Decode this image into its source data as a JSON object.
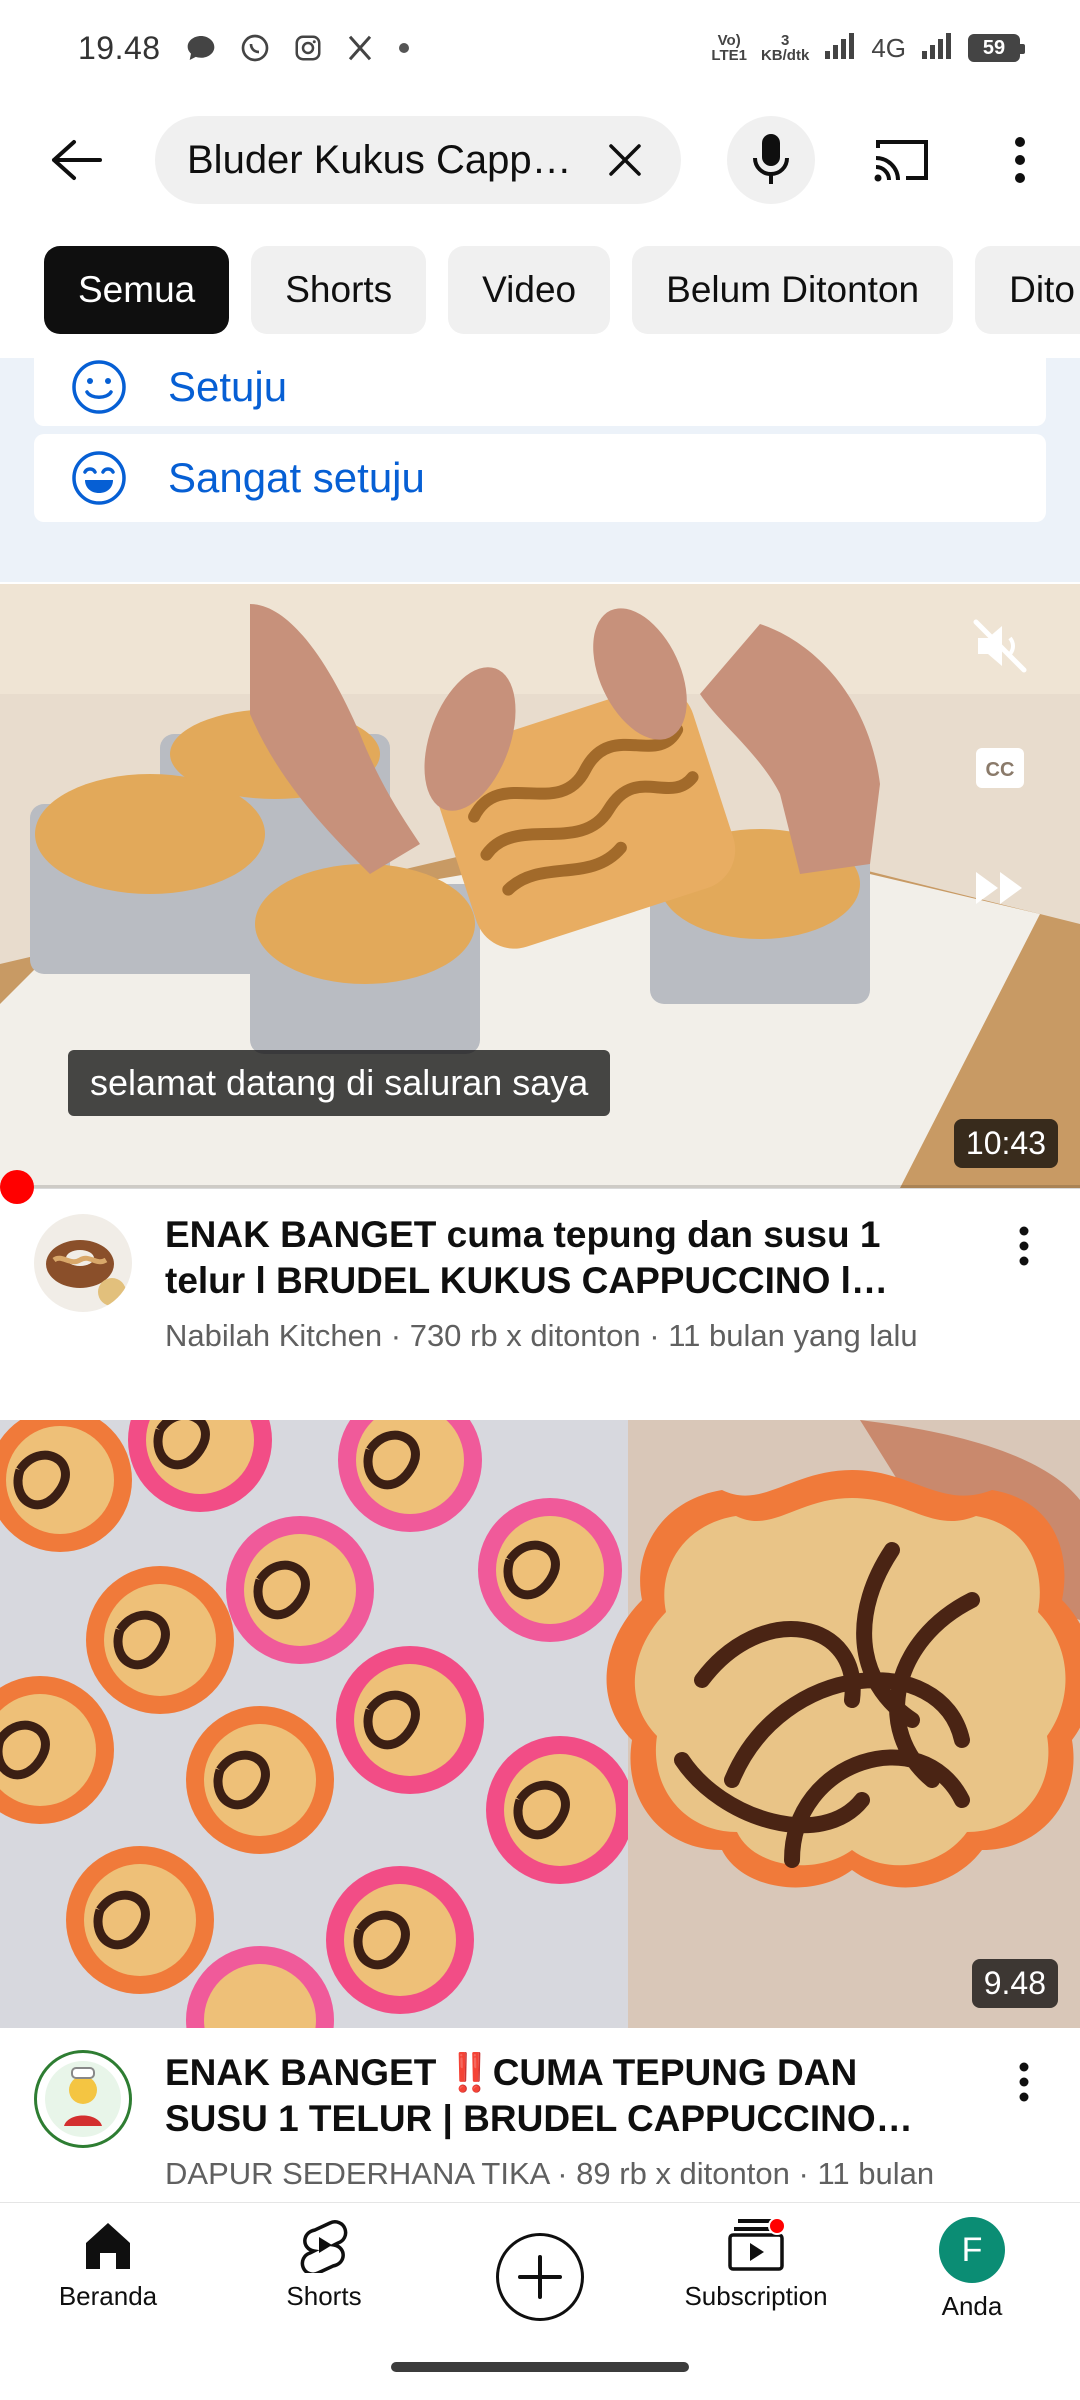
{
  "status_bar": {
    "time": "19.48",
    "network_type": "4G",
    "speed_value": "3",
    "speed_unit": "KB/dtk",
    "volte_top": "Vo)",
    "volte_bottom": "LTE1",
    "battery": "59",
    "notification_icons": [
      "chat-icon",
      "whatsapp-icon",
      "instagram-icon",
      "x-icon",
      "dot-icon"
    ]
  },
  "header": {
    "search_value": "Bluder Kukus Cappuccino",
    "back_icon": "arrow-left-icon",
    "clear_icon": "close-icon",
    "mic_icon": "mic-icon",
    "cast_icon": "cast-icon",
    "more_icon": "more-vert-icon"
  },
  "chips": [
    {
      "label": "Semua",
      "active": true
    },
    {
      "label": "Shorts",
      "active": false
    },
    {
      "label": "Video",
      "active": false
    },
    {
      "label": "Belum Ditonton",
      "active": false
    },
    {
      "label": "Dito",
      "active": false
    }
  ],
  "survey": {
    "options": [
      {
        "label": "Setuju",
        "icon": "smile-icon"
      },
      {
        "label": "Sangat setuju",
        "icon": "laugh-icon"
      }
    ]
  },
  "videos": [
    {
      "title": "ENAK BANGET cuma tepung dan susu 1 telur l BRUDEL KUKUS CAPPUCCINO l hanya...",
      "channel": "Nabilah Kitchen",
      "views": "730 rb x ditonton",
      "age": "11 bulan yang lalu",
      "duration": "10:43",
      "caption": "selamat datang di saluran saya",
      "playing": true
    },
    {
      "title": "ENAK BANGET ‼️CUMA TEPUNG DAN SUSU 1 TELUR | BRUDEL CAPPUCCINO HANYA D...",
      "channel": "DAPUR SEDERHANA TIKA",
      "views": "89 rb x ditonton",
      "age": "11 bulan",
      "duration": "9.48",
      "playing": false
    }
  ],
  "bottom_nav": {
    "items": [
      {
        "label": "Beranda",
        "icon": "home-icon",
        "active": true
      },
      {
        "label": "Shorts",
        "icon": "shorts-icon"
      },
      {
        "label": "",
        "icon": "plus-circle-icon"
      },
      {
        "label": "Subscription",
        "icon": "subscriptions-icon",
        "badge": true
      },
      {
        "label": "Anda",
        "icon": "avatar"
      }
    ],
    "avatar_letter": "F",
    "avatar_color": "#0b8d74"
  },
  "colors": {
    "link_blue": "#065fd4",
    "survey_bg": "#ecf2f9",
    "chip_bg": "#f0f0f0",
    "chip_active_bg": "#0f0f0f",
    "accent_red": "#ff0000"
  }
}
